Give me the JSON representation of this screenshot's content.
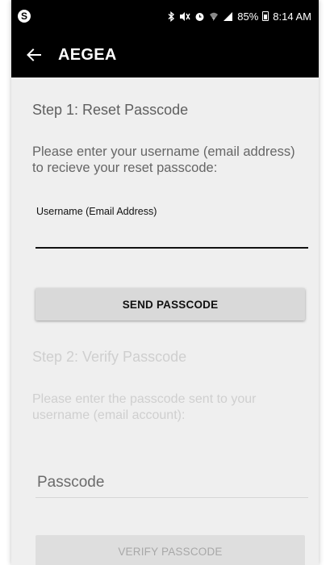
{
  "status_bar": {
    "app_icon": "skype-icon",
    "battery_percent": "85%",
    "time": "8:14 AM"
  },
  "app_bar": {
    "title": "AEGEA"
  },
  "step1": {
    "title": "Step 1: Reset Passcode",
    "instructions": "Please enter your username (email address) to recieve your reset passcode:",
    "username_label": "Username (Email Address)",
    "username_value": "",
    "send_button": "SEND PASSCODE"
  },
  "step2": {
    "title": "Step 2: Verify Passcode",
    "instructions": "Please enter the passcode sent to your username (email account):",
    "passcode_placeholder": "Passcode",
    "verify_button": "VERIFY PASSCODE"
  },
  "colors": {
    "bar_background": "#000000",
    "content_background": "#efefef",
    "button_active": "#d9d9d9",
    "disabled_text": "#cfcfcf"
  }
}
